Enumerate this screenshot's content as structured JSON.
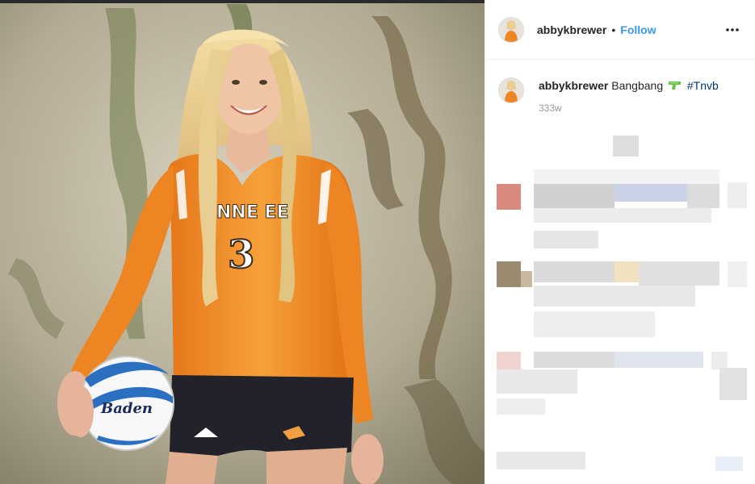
{
  "post": {
    "username": "abbykbrewer",
    "separator": "•",
    "follow_label": "Follow",
    "more_icon": "more-options-icon",
    "caption": {
      "username": "abbykbrewer",
      "text": "Bangbang",
      "emoji": "water-pistol-emoji",
      "hashtag": "#Tnvb"
    },
    "timestamp": "333w"
  },
  "photo": {
    "jersey_text": "NNE EE",
    "jersey_number": "3",
    "ball_brand": "Baden",
    "colors": {
      "jersey": "#f08a24",
      "wall": "#b5ad97",
      "ball_blue": "#2a6fc0"
    }
  },
  "colors": {
    "link_blue": "#3897f0",
    "hashtag_blue": "#003569",
    "text": "#262626",
    "muted": "#999999",
    "border": "#efefef"
  }
}
